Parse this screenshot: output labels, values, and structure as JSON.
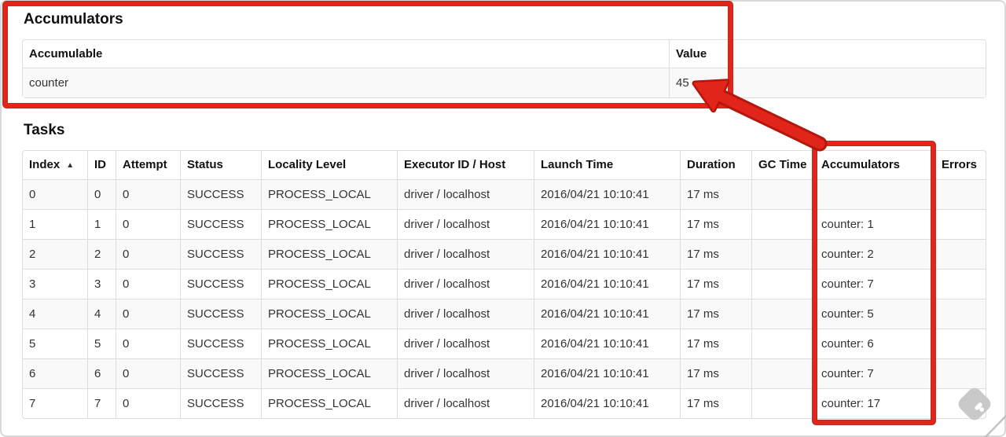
{
  "accumulators": {
    "heading": "Accumulators",
    "columns": {
      "accumulable": "Accumulable",
      "value": "Value"
    },
    "rows": [
      {
        "accumulable": "counter",
        "value": "45"
      }
    ]
  },
  "tasks": {
    "heading": "Tasks",
    "columns": [
      "Index",
      "ID",
      "Attempt",
      "Status",
      "Locality Level",
      "Executor ID / Host",
      "Launch Time",
      "Duration",
      "GC Time",
      "Accumulators",
      "Errors"
    ],
    "sort": {
      "column": "Index",
      "direction": "asc",
      "icon": "▲"
    },
    "rows": [
      [
        "0",
        "0",
        "0",
        "SUCCESS",
        "PROCESS_LOCAL",
        "driver / localhost",
        "2016/04/21 10:10:41",
        "17 ms",
        "",
        "",
        ""
      ],
      [
        "1",
        "1",
        "0",
        "SUCCESS",
        "PROCESS_LOCAL",
        "driver / localhost",
        "2016/04/21 10:10:41",
        "17 ms",
        "",
        "counter: 1",
        ""
      ],
      [
        "2",
        "2",
        "0",
        "SUCCESS",
        "PROCESS_LOCAL",
        "driver / localhost",
        "2016/04/21 10:10:41",
        "17 ms",
        "",
        "counter: 2",
        ""
      ],
      [
        "3",
        "3",
        "0",
        "SUCCESS",
        "PROCESS_LOCAL",
        "driver / localhost",
        "2016/04/21 10:10:41",
        "17 ms",
        "",
        "counter: 7",
        ""
      ],
      [
        "4",
        "4",
        "0",
        "SUCCESS",
        "PROCESS_LOCAL",
        "driver / localhost",
        "2016/04/21 10:10:41",
        "17 ms",
        "",
        "counter: 5",
        ""
      ],
      [
        "5",
        "5",
        "0",
        "SUCCESS",
        "PROCESS_LOCAL",
        "driver / localhost",
        "2016/04/21 10:10:41",
        "17 ms",
        "",
        "counter: 6",
        ""
      ],
      [
        "6",
        "6",
        "0",
        "SUCCESS",
        "PROCESS_LOCAL",
        "driver / localhost",
        "2016/04/21 10:10:41",
        "17 ms",
        "",
        "counter: 7",
        ""
      ],
      [
        "7",
        "7",
        "0",
        "SUCCESS",
        "PROCESS_LOCAL",
        "driver / localhost",
        "2016/04/21 10:10:41",
        "17 ms",
        "",
        "counter: 17",
        ""
      ]
    ]
  },
  "annotations": {
    "color": "#e2251a",
    "outline_color": "#b3170d",
    "box1_target": "accumulators summary with value 45",
    "box2_target": "tasks accumulators column",
    "arrow_points_to": "45"
  }
}
